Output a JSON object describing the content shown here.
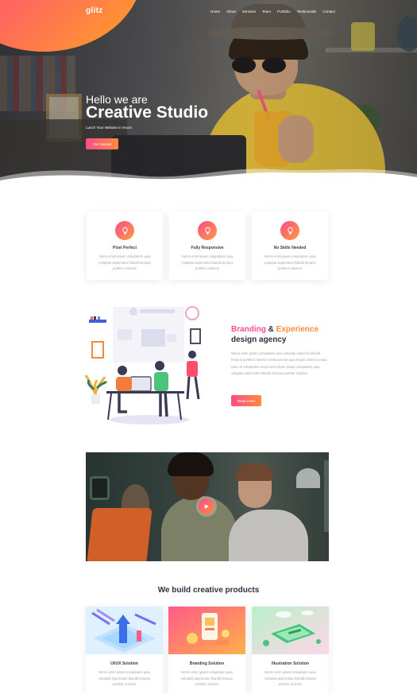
{
  "brand": {
    "logo": "glitz"
  },
  "nav": {
    "items": [
      "Home",
      "About",
      "Services",
      "Team",
      "Portfolio",
      "Testimonials",
      "Contact"
    ]
  },
  "hero": {
    "greeting": "Hello we are",
    "title": "Creative Studio",
    "subtitle": "Lunch Your Website in Hours",
    "cta": "Get Started"
  },
  "features": [
    {
      "title": "Pixel Perfect",
      "icon": "lightbulb-icon",
      "text": "Nemo enim ipsam voluptatem quia voluptas aspernatur blandit tempus porttitor maxime"
    },
    {
      "title": "Fully Responsive",
      "icon": "lightbulb-icon",
      "text": "Nemo enim ipsam voluptatem quia voluptas aspernatur blandit tempus porttitor maxime"
    },
    {
      "title": "No Skills Needed",
      "icon": "lightbulb-icon",
      "text": "Nemo enim ipsam voluptatem quia voluptas aspernatur blandit tempus porttitor maxime"
    }
  ],
  "agency": {
    "word1": "Branding",
    "amp": " & ",
    "word2": "Experience",
    "line2": "design agency",
    "text": "Nemo enim ipsam voluptatem quia voluptas aspernat blandit tempus porttitor maxime consequuntur quia magni dolores eosqu ratio ne voluptatem sequi nesci Enim ipsam voluptatem quia voluptas aspernatur blandit tempus porttitor maxime",
    "cta": "Read more"
  },
  "video": {
    "play_icon": "play-icon"
  },
  "products": {
    "title": "We build creative products",
    "items": [
      {
        "title": "UI/UX Solution",
        "text": "Nemo enim ipsam voluptatem quia voluptas aspernatur blandit tempus porttitor maxime"
      },
      {
        "title": "Branding Solution",
        "text": "Nemo enim ipsam voluptatem quia voluptas aspernatur blandit tempus porttitor maxime"
      },
      {
        "title": "Illustration Solution",
        "text": "Nemo enim ipsam voluptatem quia voluptas aspernatur blandit tempus porttitor maxime"
      }
    ]
  },
  "colors": {
    "accent_start": "#ff4d8d",
    "accent_end": "#ff8a3c",
    "heading": "#2f2f3f",
    "body_text": "#a3a3b3"
  }
}
